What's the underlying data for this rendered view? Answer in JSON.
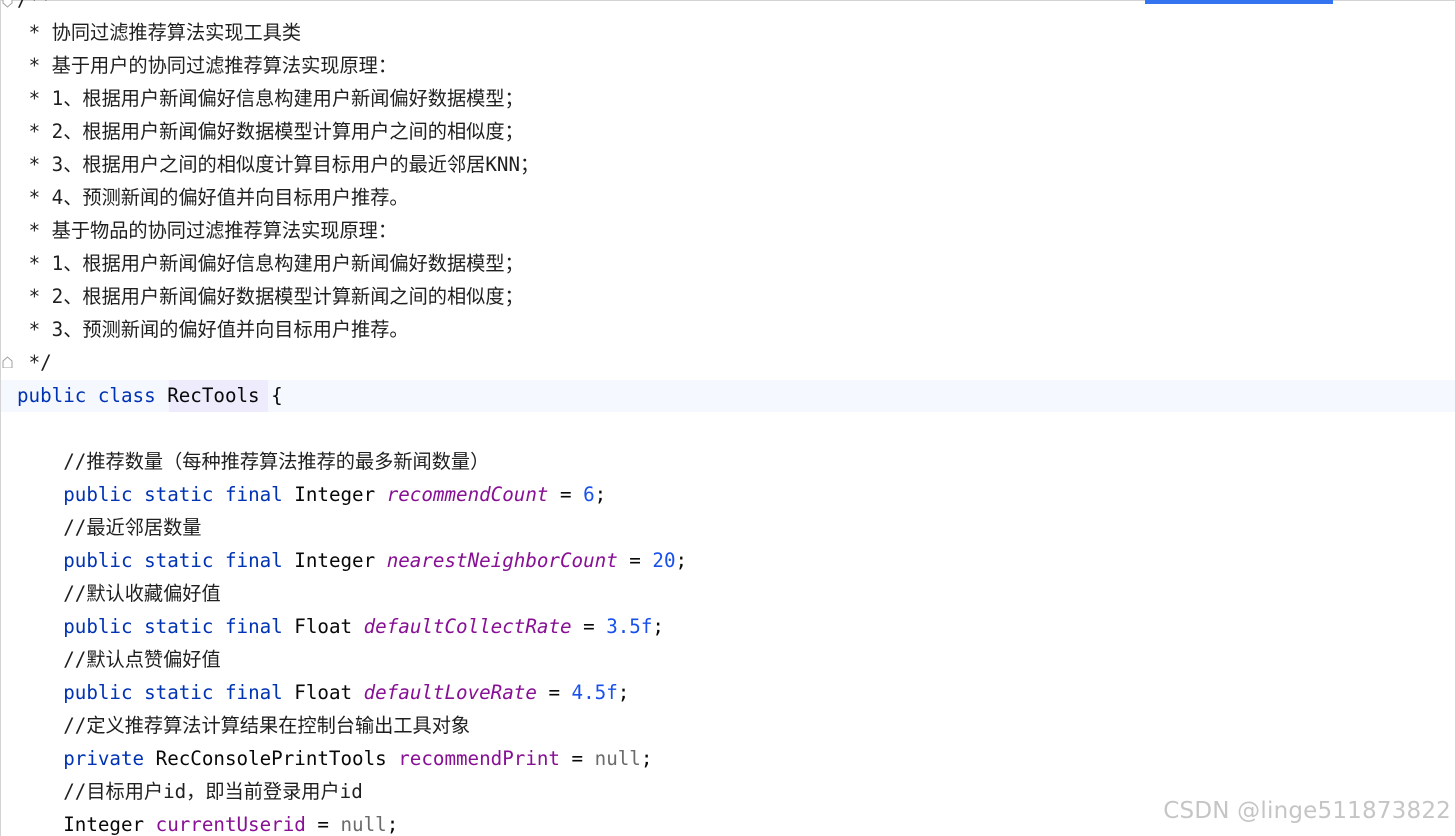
{
  "editor": {
    "language": "java",
    "colors": {
      "keyword": "#0033b3",
      "number": "#1750eb",
      "static_field": "#871094",
      "null_literal": "#6b6b6b",
      "accent_tab": "#3574f0"
    },
    "lines": [
      {
        "indent": "",
        "tokens": [
          {
            "t": "/**",
            "c": "doc"
          }
        ]
      },
      {
        "indent": " ",
        "tokens": [
          {
            "t": "* 协同过滤推荐算法实现工具类",
            "c": "doc"
          }
        ]
      },
      {
        "indent": " ",
        "tokens": [
          {
            "t": "* 基于用户的协同过滤推荐算法实现原理：",
            "c": "doc"
          }
        ]
      },
      {
        "indent": " ",
        "tokens": [
          {
            "t": "* 1、根据用户新闻偏好信息构建用户新闻偏好数据模型；",
            "c": "doc"
          }
        ]
      },
      {
        "indent": " ",
        "tokens": [
          {
            "t": "* 2、根据用户新闻偏好数据模型计算用户之间的相似度；",
            "c": "doc"
          }
        ]
      },
      {
        "indent": " ",
        "tokens": [
          {
            "t": "* 3、根据用户之间的相似度计算目标用户的最近邻居KNN；",
            "c": "doc"
          }
        ]
      },
      {
        "indent": " ",
        "tokens": [
          {
            "t": "* 4、预测新闻的偏好值并向目标用户推荐。",
            "c": "doc"
          }
        ]
      },
      {
        "indent": " ",
        "tokens": [
          {
            "t": "* 基于物品的协同过滤推荐算法实现原理：",
            "c": "doc"
          }
        ]
      },
      {
        "indent": " ",
        "tokens": [
          {
            "t": "* 1、根据用户新闻偏好信息构建用户新闻偏好数据模型；",
            "c": "doc"
          }
        ]
      },
      {
        "indent": " ",
        "tokens": [
          {
            "t": "* 2、根据用户新闻偏好数据模型计算新闻之间的相似度；",
            "c": "doc"
          }
        ]
      },
      {
        "indent": " ",
        "tokens": [
          {
            "t": "* 3、预测新闻的偏好值并向目标用户推荐。",
            "c": "doc"
          }
        ]
      },
      {
        "indent": " ",
        "tokens": [
          {
            "t": "*/",
            "c": "doc"
          }
        ]
      },
      {
        "indent": "",
        "tokens": [
          {
            "t": "public",
            "c": "kw"
          },
          {
            "t": " ",
            "c": "plain"
          },
          {
            "t": "class",
            "c": "kw"
          },
          {
            "t": " RecTools {",
            "c": "plain"
          }
        ]
      },
      {
        "indent": "",
        "tokens": []
      },
      {
        "indent": "    ",
        "tokens": [
          {
            "t": "//推荐数量（每种推荐算法推荐的最多新闻数量）",
            "c": "comment"
          }
        ]
      },
      {
        "indent": "    ",
        "tokens": [
          {
            "t": "public",
            "c": "kw"
          },
          {
            "t": " ",
            "c": "plain"
          },
          {
            "t": "static",
            "c": "kw"
          },
          {
            "t": " ",
            "c": "plain"
          },
          {
            "t": "final",
            "c": "kw"
          },
          {
            "t": " Integer ",
            "c": "plain"
          },
          {
            "t": "recommendCount",
            "c": "field"
          },
          {
            "t": " = ",
            "c": "plain"
          },
          {
            "t": "6",
            "c": "num"
          },
          {
            "t": ";",
            "c": "plain"
          }
        ]
      },
      {
        "indent": "    ",
        "tokens": [
          {
            "t": "//最近邻居数量",
            "c": "comment"
          }
        ]
      },
      {
        "indent": "    ",
        "tokens": [
          {
            "t": "public",
            "c": "kw"
          },
          {
            "t": " ",
            "c": "plain"
          },
          {
            "t": "static",
            "c": "kw"
          },
          {
            "t": " ",
            "c": "plain"
          },
          {
            "t": "final",
            "c": "kw"
          },
          {
            "t": " Integer ",
            "c": "plain"
          },
          {
            "t": "nearestNeighborCount",
            "c": "field"
          },
          {
            "t": " = ",
            "c": "plain"
          },
          {
            "t": "20",
            "c": "num"
          },
          {
            "t": ";",
            "c": "plain"
          }
        ]
      },
      {
        "indent": "    ",
        "tokens": [
          {
            "t": "//默认收藏偏好值",
            "c": "comment"
          }
        ]
      },
      {
        "indent": "    ",
        "tokens": [
          {
            "t": "public",
            "c": "kw"
          },
          {
            "t": " ",
            "c": "plain"
          },
          {
            "t": "static",
            "c": "kw"
          },
          {
            "t": " ",
            "c": "plain"
          },
          {
            "t": "final",
            "c": "kw"
          },
          {
            "t": " Float ",
            "c": "plain"
          },
          {
            "t": "defaultCollectRate",
            "c": "field"
          },
          {
            "t": " = ",
            "c": "plain"
          },
          {
            "t": "3.5f",
            "c": "num"
          },
          {
            "t": ";",
            "c": "plain"
          }
        ]
      },
      {
        "indent": "    ",
        "tokens": [
          {
            "t": "//默认点赞偏好值",
            "c": "comment"
          }
        ]
      },
      {
        "indent": "    ",
        "tokens": [
          {
            "t": "public",
            "c": "kw"
          },
          {
            "t": " ",
            "c": "plain"
          },
          {
            "t": "static",
            "c": "kw"
          },
          {
            "t": " ",
            "c": "plain"
          },
          {
            "t": "final",
            "c": "kw"
          },
          {
            "t": " Float ",
            "c": "plain"
          },
          {
            "t": "defaultLoveRate",
            "c": "field"
          },
          {
            "t": " = ",
            "c": "plain"
          },
          {
            "t": "4.5f",
            "c": "num"
          },
          {
            "t": ";",
            "c": "plain"
          }
        ]
      },
      {
        "indent": "    ",
        "tokens": [
          {
            "t": "//定义推荐算法计算结果在控制台输出工具对象",
            "c": "comment"
          }
        ]
      },
      {
        "indent": "    ",
        "tokens": [
          {
            "t": "private",
            "c": "kw"
          },
          {
            "t": " RecConsolePrintTools ",
            "c": "plain"
          },
          {
            "t": "recommendPrint",
            "c": "ifield"
          },
          {
            "t": " = ",
            "c": "plain"
          },
          {
            "t": "null",
            "c": "nul"
          },
          {
            "t": ";",
            "c": "plain"
          }
        ]
      },
      {
        "indent": "    ",
        "tokens": [
          {
            "t": "//目标用户id，即当前登录用户id",
            "c": "comment"
          }
        ]
      },
      {
        "indent": "    ",
        "tokens": [
          {
            "t": "Integer ",
            "c": "plain"
          },
          {
            "t": "currentUserid",
            "c": "ifield"
          },
          {
            "t": " = ",
            "c": "plain"
          },
          {
            "t": "null",
            "c": "nul"
          },
          {
            "t": ";",
            "c": "plain"
          }
        ]
      }
    ]
  },
  "watermark": {
    "text": "CSDN @linge511873822"
  }
}
